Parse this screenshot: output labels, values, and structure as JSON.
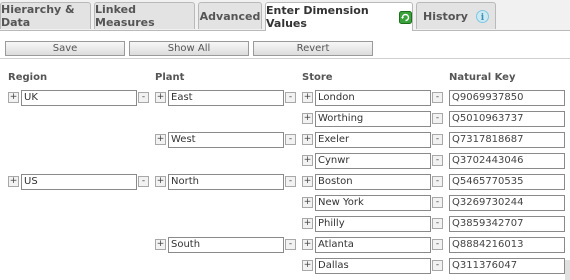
{
  "tabs": [
    {
      "label": "Hierarchy & Data"
    },
    {
      "label": "Linked Measures"
    },
    {
      "label": "Advanced"
    },
    {
      "label": "Enter Dimension Values"
    },
    {
      "label": "History"
    }
  ],
  "toolbar": {
    "save": "Save",
    "show_all": "Show All",
    "revert": "Revert"
  },
  "columns": {
    "region": "Region",
    "plant": "Plant",
    "store": "Store",
    "key": "Natural Key"
  },
  "icons": {
    "expand": "+",
    "collapse": "-"
  },
  "rows": [
    {
      "region": "UK",
      "plant": "East",
      "store": "London",
      "key": "Q9069937850"
    },
    {
      "store": "Worthing",
      "key": "Q5010963737"
    },
    {
      "plant": "West",
      "store": "Exeler",
      "key": "Q7317818687"
    },
    {
      "store": "Cynwr",
      "key": "Q3702443046"
    },
    {
      "region": "US",
      "plant": "North",
      "store": "Boston",
      "key": "Q5465770535"
    },
    {
      "store": "New York",
      "key": "Q3269730244"
    },
    {
      "store": "Philly",
      "key": "Q3859342707"
    },
    {
      "plant": "South",
      "store": "Atlanta",
      "key": "Q8884216013"
    },
    {
      "store": "Dallas",
      "key": "Q311376047"
    }
  ],
  "colors": {
    "accent": "#2e8b2e",
    "history_icon": "#7fc7e0"
  }
}
